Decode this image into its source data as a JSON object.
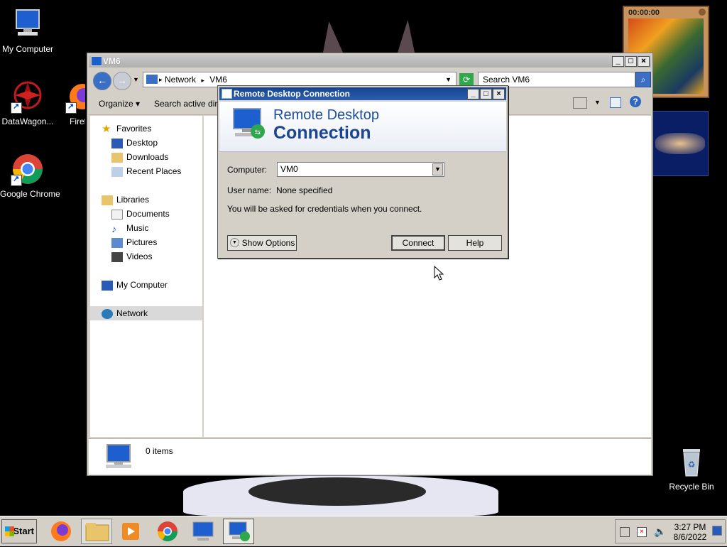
{
  "desktop": {
    "icons": [
      {
        "label": "My Computer"
      },
      {
        "label": "DataWagon..."
      },
      {
        "label": "Firef"
      },
      {
        "label": "Google Chrome"
      },
      {
        "label": "Recycle Bin"
      }
    ],
    "gadget_clock": "00:00:00"
  },
  "explorer": {
    "title": "VM6",
    "breadcrumb": [
      "Network",
      "VM6"
    ],
    "search_placeholder": "Search VM6",
    "commands": {
      "organize": "Organize",
      "search_ad": "Search active direc"
    },
    "nav": {
      "favorites": "Favorites",
      "desktop": "Desktop",
      "downloads": "Downloads",
      "recent": "Recent Places",
      "libraries": "Libraries",
      "documents": "Documents",
      "music": "Music",
      "pictures": "Pictures",
      "videos": "Videos",
      "my_computer": "My Computer",
      "network": "Network"
    },
    "status": "0 items"
  },
  "rdc": {
    "title": "Remote Desktop Connection",
    "banner_line1": "Remote Desktop",
    "banner_line2": "Connection",
    "computer_label": "Computer:",
    "computer_value": "VM0",
    "username_label": "User name:",
    "username_value": "None specified",
    "note": "You will be asked for credentials when you connect.",
    "show_options": "Show Options",
    "connect": "Connect",
    "help": "Help"
  },
  "taskbar": {
    "start": "Start",
    "time": "3:27 PM",
    "date": "8/6/2022"
  },
  "colors": {
    "titlebar_active": "#15438f",
    "banner_text": "#1c4591",
    "desktop_bg": "#000000"
  }
}
